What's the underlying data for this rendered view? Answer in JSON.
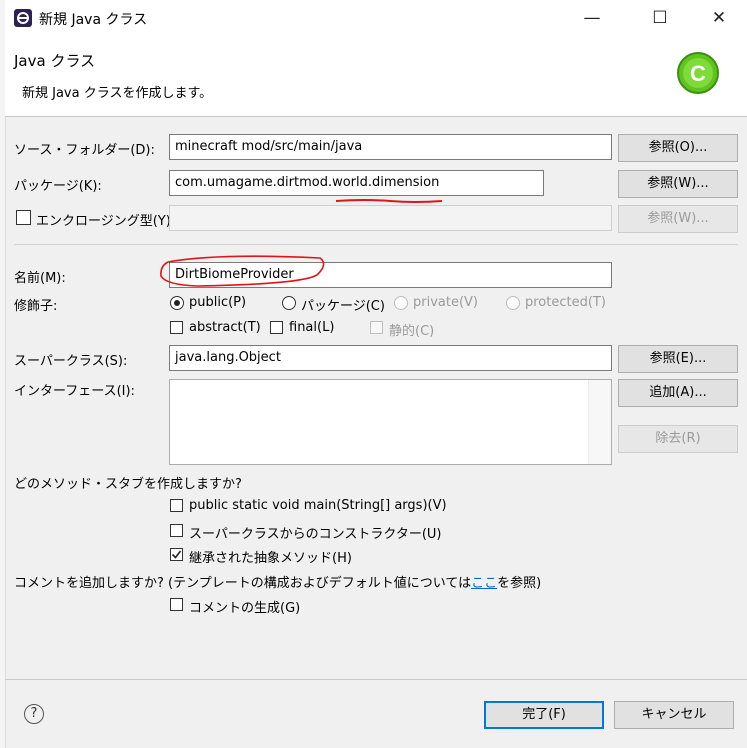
{
  "window": {
    "title": "新規 Java クラス",
    "minimize": "—",
    "maximize": "☐",
    "close": "✕"
  },
  "header": {
    "title": "Java クラス",
    "description": "新規 Java クラスを作成します。",
    "banner_icon_letter": "C"
  },
  "colors": {
    "accent": "#0078d7",
    "banner_green": "#5fc41f",
    "annotation_red": "#e0151b",
    "link": "#0066cc"
  },
  "fields": {
    "source_folder": {
      "label": "ソース・フォルダー(D):",
      "value": "minecraft mod/src/main/java",
      "browse": "参照(O)..."
    },
    "package": {
      "label": "パッケージ(K):",
      "value": "com.umagame.dirtmod.world.dimension",
      "browse": "参照(W)..."
    },
    "enclosing": {
      "label": "エンクロージング型(Y):",
      "value": "",
      "browse": "参照(W)...",
      "checked": false
    },
    "name": {
      "label": "名前(M):",
      "value": "DirtBiomeProvider"
    },
    "modifiers": {
      "label": "修飾子:",
      "public": "public(P)",
      "package": "パッケージ(C)",
      "private": "private(V)",
      "protected": "protected(T)",
      "abstract": "abstract(T)",
      "final": "final(L)",
      "static": "静的(C)",
      "selected": "public(P)"
    },
    "superclass": {
      "label": "スーパークラス(S):",
      "value": "java.lang.Object",
      "browse": "参照(E)..."
    },
    "interfaces": {
      "label": "インターフェース(I):",
      "add": "追加(A)...",
      "remove": "除去(R)"
    }
  },
  "stubs": {
    "question": "どのメソッド・スタブを作成しますか?",
    "main": {
      "label": "public static void main(String[] args)(V)",
      "checked": false
    },
    "constructors": {
      "label": "スーパークラスからのコンストラクター(U)",
      "checked": false
    },
    "inherited": {
      "label": "継承された抽象メソッド(H)",
      "checked": true
    }
  },
  "comments": {
    "question_before": "コメントを追加しますか? (テンプレートの構成およびデフォルト値については",
    "link": "ここ",
    "question_after": "を参照)",
    "generate": {
      "label": "コメントの生成(G)",
      "checked": false
    }
  },
  "footer": {
    "help": "?",
    "finish": "完了(F)",
    "cancel": "キャンセル"
  }
}
